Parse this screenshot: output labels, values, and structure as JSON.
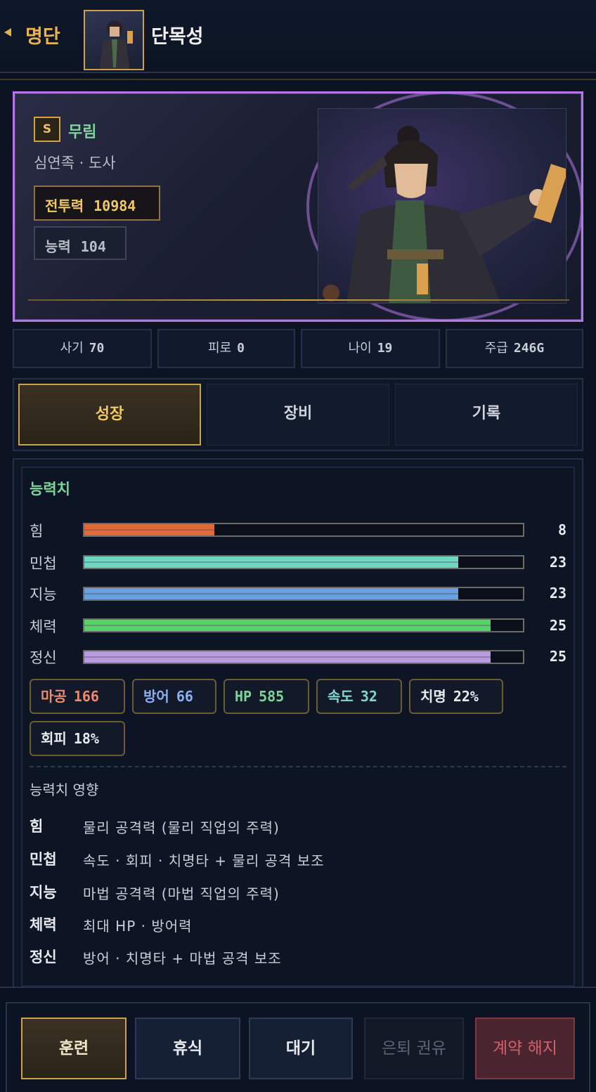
{
  "header": {
    "back_label": "명단",
    "character_name": "단목성"
  },
  "card": {
    "rank": "S",
    "faction": "무림",
    "race_class": "심연족 · 도사",
    "power_label": "전투력",
    "power_value": "10984",
    "ability_label": "능력",
    "ability_value": "104"
  },
  "stats_strip": [
    {
      "label": "사기",
      "value": "70"
    },
    {
      "label": "피로",
      "value": "0"
    },
    {
      "label": "나이",
      "value": "19"
    },
    {
      "label": "주급",
      "value": "246G"
    }
  ],
  "tabs": [
    {
      "label": "성장",
      "active": true
    },
    {
      "label": "장비",
      "active": false
    },
    {
      "label": "기록",
      "active": false
    }
  ],
  "attributes": {
    "title": "능력치",
    "max": 27,
    "items": [
      {
        "label": "힘",
        "value": 8,
        "color": "#e06a3a"
      },
      {
        "label": "민첩",
        "value": 23,
        "color": "#6fd8c2"
      },
      {
        "label": "지능",
        "value": 23,
        "color": "#6a9fe0"
      },
      {
        "label": "체력",
        "value": 25,
        "color": "#5bd06a"
      },
      {
        "label": "정신",
        "value": 25,
        "color": "#b89ae0"
      }
    ]
  },
  "derived": [
    {
      "label": "마공",
      "value": "166",
      "color": "#f08a6a"
    },
    {
      "label": "방어",
      "value": "66",
      "color": "#8ab0f0"
    },
    {
      "label": "HP",
      "value": "585",
      "color": "#7dd59a"
    },
    {
      "label": "속도",
      "value": "32",
      "color": "#7fd8d0"
    },
    {
      "label": "치명",
      "value": "22%",
      "color": "#e8eaef"
    },
    {
      "label": "회피",
      "value": "18%",
      "color": "#e8eaef"
    }
  ],
  "effects": {
    "title": "능력치 영향",
    "items": [
      {
        "key": "힘",
        "desc": "물리 공격력 (물리 직업의 주력)"
      },
      {
        "key": "민첩",
        "desc": "속도 · 회피 · 치명타 + 물리 공격 보조"
      },
      {
        "key": "지능",
        "desc": "마법 공격력 (마법 직업의 주력)"
      },
      {
        "key": "체력",
        "desc": "최대 HP · 방어력"
      },
      {
        "key": "정신",
        "desc": "방어 · 치명타 + 마법 공격 보조"
      }
    ]
  },
  "actions": {
    "train": "훈련",
    "rest": "휴식",
    "wait": "대기",
    "retire": "은퇴 권유",
    "fire": "계약 해지"
  }
}
